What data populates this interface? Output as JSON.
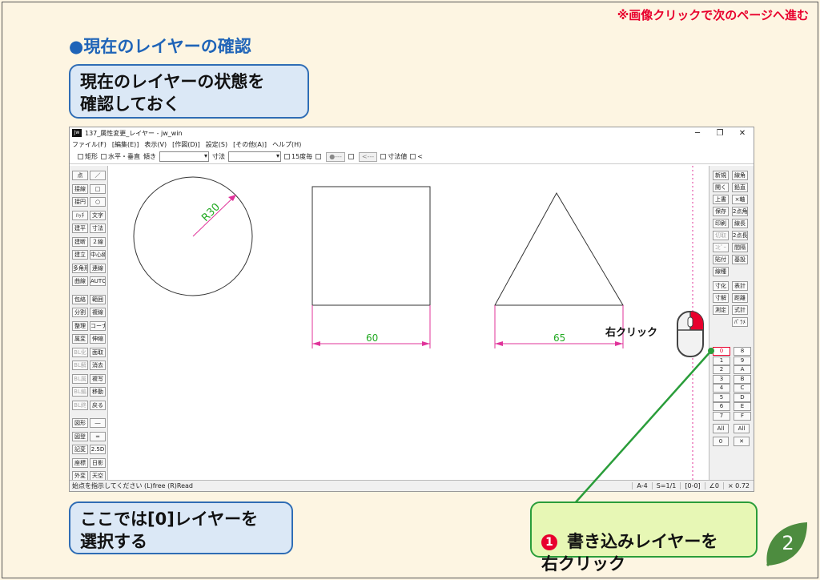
{
  "nav_hint": "※画像クリックで次のページへ進む",
  "heading": "●現在のレイヤーの確認",
  "callout_top": "現在のレイヤーの状態を\n確認しておく",
  "callout_bottom": "ここでは[0]レイヤーを\n選択する",
  "callout_step": {
    "badge": "1",
    "text": "書き込みレイヤーを\n右クリック"
  },
  "page_number": "2",
  "mouse_label": "右クリック",
  "window": {
    "title": "137_属性変更_レイヤー - jw_win",
    "icon_text": "Jw",
    "menu": [
      "ファイル(F)",
      "[編集(E)]",
      "表示(V)",
      "[作図(D)]",
      "設定(S)",
      "[その他(A)]",
      "ヘルプ(H)"
    ],
    "toolbar": {
      "rect_label": "矩形",
      "hv_label": "水平・垂直",
      "slope_label": "傾き",
      "dim_label": "寸法",
      "deg15_label": "15度毎",
      "btn_a": "●---",
      "btn_b": "<---",
      "dimval_label": "寸法値",
      "last_label": "<"
    },
    "left_tools": [
      [
        "点",
        "／"
      ],
      [
        "接線",
        "□"
      ],
      [
        "接円",
        "○"
      ],
      [
        "ﾊｯﾁ",
        "文字"
      ],
      [
        "建平",
        "寸法"
      ],
      [
        "建断",
        "２線"
      ],
      [
        "建立",
        "中心線"
      ],
      [
        "多角形",
        "連線"
      ],
      [
        "曲線",
        "AUTO"
      ],
      [
        "包絡",
        "範囲"
      ],
      [
        "分割",
        "複線"
      ],
      [
        "整理",
        "コーナー"
      ],
      [
        "属変",
        "伸縮"
      ],
      [
        "BL化",
        "面取"
      ],
      [
        "BL解",
        "消去"
      ],
      [
        "BL属",
        "複写"
      ],
      [
        "BL編",
        "移動"
      ],
      [
        "BL終",
        "戻る"
      ],
      [
        "図形",
        "―"
      ],
      [
        "図登",
        "═"
      ],
      [
        "記変",
        "2.5D"
      ],
      [
        "座標",
        "日影"
      ],
      [
        "外変",
        "天空"
      ]
    ],
    "right_tools": [
      [
        "新規",
        "開く",
        "上書",
        "保存",
        "印刷",
        "切取",
        "ｺﾋﾟｰ",
        "貼付",
        "線種"
      ],
      [
        "線角",
        "鉛直",
        "×軸",
        "2点角",
        "線長",
        "2点長",
        "間隔",
        "基設"
      ]
    ],
    "right_tools2": [
      [
        "寸化",
        "寸解",
        "測定",
        "表計",
        "距離",
        "式計",
        "ﾊﾟﾗﾒ"
      ]
    ],
    "layer_rows": [
      [
        "0",
        "8"
      ],
      [
        "1",
        "9"
      ],
      [
        "2",
        "A"
      ],
      [
        "3",
        "B"
      ],
      [
        "4",
        "C"
      ],
      [
        "5",
        "D"
      ],
      [
        "6",
        "E"
      ],
      [
        "7",
        "F"
      ]
    ],
    "layer_all": [
      "All",
      "All"
    ],
    "layer_zero": "0",
    "status_text": "始点を指示してください (L)free (R)Read",
    "status_cells": [
      "A-4",
      "S=1/1",
      "[0-0]",
      "∠0",
      "× 0.72"
    ]
  },
  "drawing": {
    "radius_label": "R30",
    "dim_square": "60",
    "dim_triangle": "65"
  },
  "colors": {
    "accent": "#e8002d",
    "heading": "#1f64b8",
    "dimension": "#e0339a",
    "pointer_line": "#2a9d3a"
  }
}
